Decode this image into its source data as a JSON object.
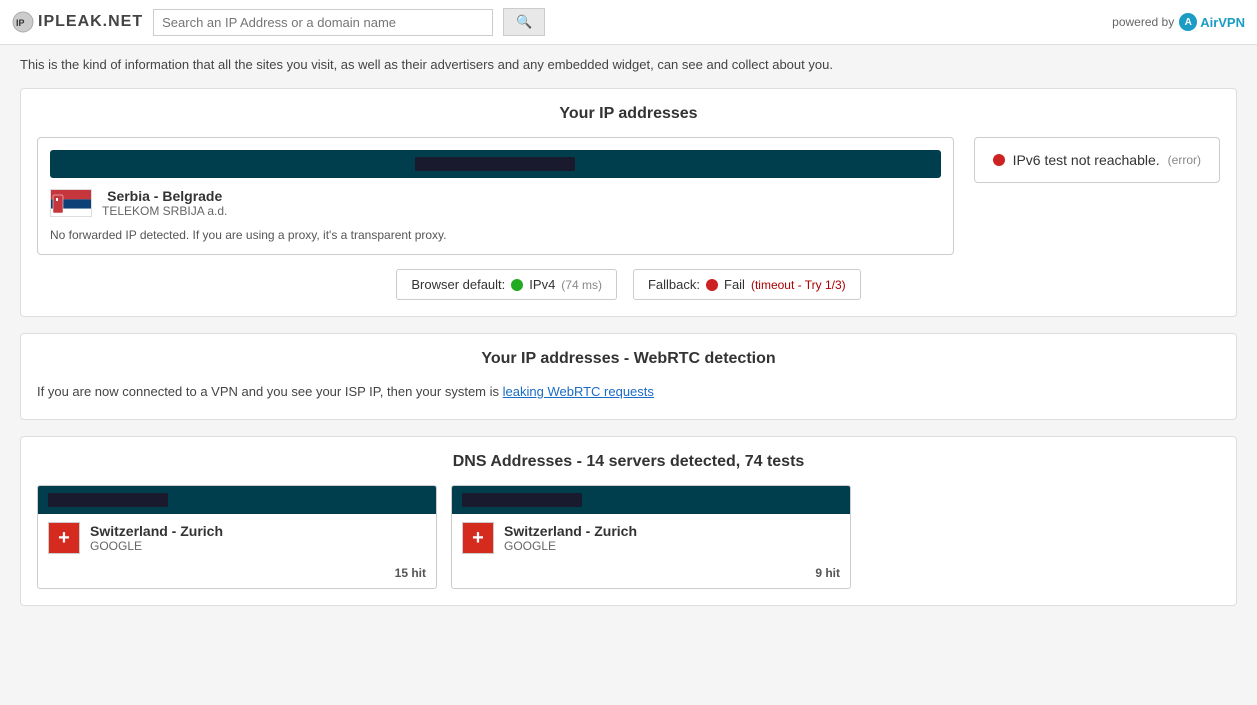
{
  "header": {
    "logo_text": "IPLEAK.NET",
    "search_placeholder": "Search an IP Address or a domain name",
    "search_button_label": "",
    "powered_by_text": "powered by",
    "airvpn_label": "AirVPN"
  },
  "intro": {
    "text": "This is the kind of information that all the sites you visit, as well as their advertisers and any embedded widget, can see and collect about you."
  },
  "ip_section": {
    "title": "Your IP addresses",
    "location_name": "Serbia - Belgrade",
    "location_isp": "TELEKOM SRBIJA a.d.",
    "forwarded_text": "No forwarded IP detected. If you are using a proxy, it's a transparent proxy.",
    "ipv6_status": "IPv6 test not reachable.",
    "ipv6_error": "(error)",
    "browser_default_label": "Browser default:",
    "browser_protocol": "IPv4",
    "browser_ms": "(74 ms)",
    "fallback_label": "Fallback:",
    "fallback_status": "Fail",
    "fallback_detail": "(timeout - Try 1/3)"
  },
  "webrtc_section": {
    "title": "Your IP addresses - WebRTC detection",
    "text": "If you are now connected to a VPN and you see your ISP IP, then your system is",
    "link_text": "leaking WebRTC requests"
  },
  "dns_section": {
    "title": "DNS Addresses - 14 servers detected, 74 tests",
    "entries": [
      {
        "country": "Switzerland - Zurich",
        "isp": "GOOGLE",
        "hits": "15 hit"
      },
      {
        "country": "Switzerland - Zurich",
        "isp": "GOOGLE",
        "hits": "9 hit"
      }
    ]
  }
}
